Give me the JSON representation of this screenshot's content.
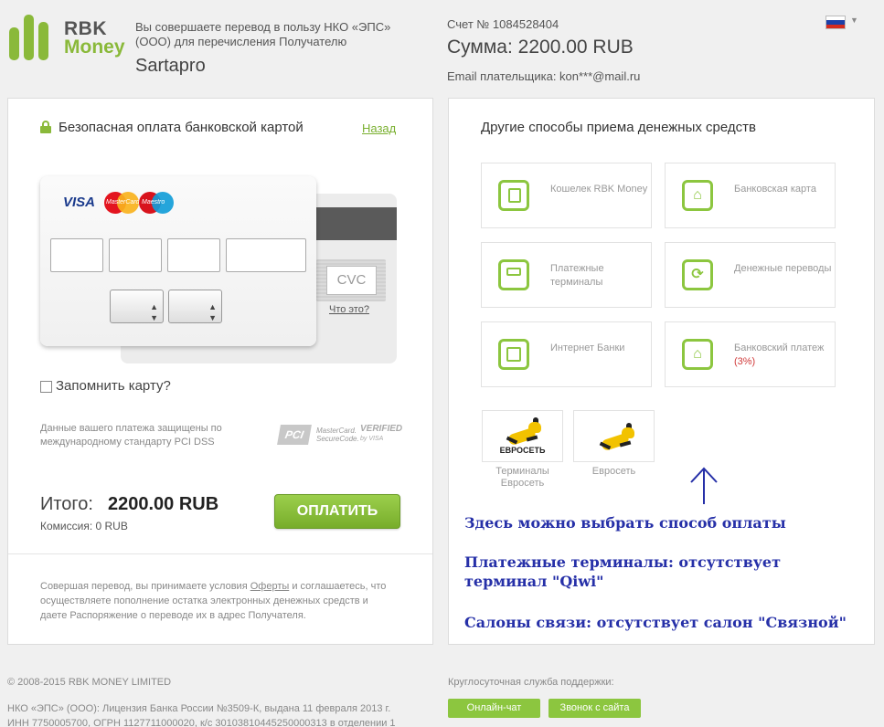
{
  "brand": {
    "line1": "RBK",
    "line2": "Money",
    "accent_color": "#8ab93a"
  },
  "header": {
    "payee_description": "Вы совершаете перевод в пользу НКО «ЭПС» (ООО) для перечисления Получателю",
    "payee_name": "Sartapro",
    "invoice": "Счет № 1084528404",
    "amount": "Сумма: 2200.00 RUB",
    "email": "Email плательщика: kon***@mail.ru",
    "language_flag": "russian-flag-icon"
  },
  "card_form": {
    "title": "Безопасная оплата банковской картой",
    "back_link": "Назад",
    "brands": {
      "visa": "VISA",
      "mastercard": "MasterCard",
      "maestro": "Maestro"
    },
    "cvc_placeholder": "CVC",
    "cvc_help": "Что это?",
    "remember_card": "Запомнить карту?",
    "pci_text": "Данные вашего платежа защищены по международному стандарту PCI DSS",
    "pci_logo": "PCI",
    "securecode_logo": [
      "MasterCard.",
      "SecureCode."
    ],
    "vbv_logo": [
      "VERIFIED",
      "by VISA"
    ],
    "total_label": "Итого:",
    "total_value": "2200.00 RUB",
    "fee": "Комиссия: 0 RUB",
    "pay_button": "ОПЛАТИТЬ",
    "terms_before": "Совершая перевод, вы принимаете условия ",
    "terms_link": "Оферты",
    "terms_after": " и соглашаетесь, что осуществляете пополнение остатка электронных денежных средств и даете Распоряжение о переводе их в адрес Получателя."
  },
  "other_methods": {
    "title": "Другие способы приема денежных средств",
    "methods": [
      {
        "label": "Кошелек RBK Money",
        "icon": "wallet-icon"
      },
      {
        "label": "Банковская карта",
        "icon": "bank-icon"
      },
      {
        "label": "Платежные терминалы",
        "icon": "terminal-icon"
      },
      {
        "label": "Денежные переводы",
        "icon": "transfer-icon"
      },
      {
        "label": "Интернет Банки",
        "icon": "safe-icon"
      },
      {
        "label": "Банковский платеж",
        "badge": "(3%)",
        "icon": "bank-icon"
      }
    ],
    "evroset": [
      {
        "caption": "Терминалы Евросеть",
        "logo_text": "ЕВРОСЕТЬ"
      },
      {
        "caption": "Евросеть"
      }
    ]
  },
  "annotations": {
    "choose": "Здесь можно выбрать способ оплаты",
    "terminals": "Платежные терминалы: отсутствует терминал \"Qiwi\"",
    "salons": "Салоны связи: отсутствует салон \"Связной\""
  },
  "footer": {
    "copyright": "© 2008-2015 RBK MONEY LIMITED",
    "license_line1": "НКО «ЭПС» (ООО): Лицензия Банка России №3509-К, выдана 11 февраля 2013 г.",
    "license_line2": "ИНН 7750005700, ОГРН 1127711000020, к/с 30103810445250000313 в отделении 1",
    "support": "Круглосуточная служба поддержки:",
    "chat_button": "Онлайн-чат",
    "call_button": "Звонок с сайта"
  }
}
